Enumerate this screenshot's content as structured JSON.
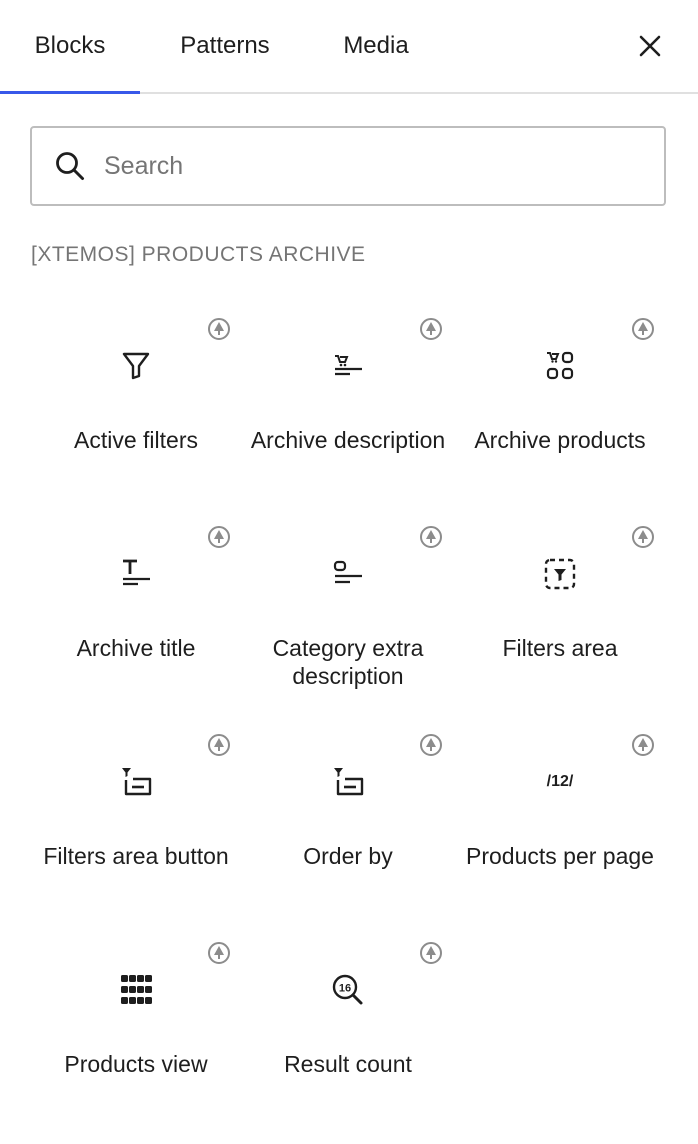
{
  "tabs": [
    {
      "label": "Blocks",
      "active": true
    },
    {
      "label": "Patterns",
      "active": false
    },
    {
      "label": "Media",
      "active": false
    }
  ],
  "close_icon": "close-icon",
  "search": {
    "placeholder": "Search",
    "value": ""
  },
  "section": {
    "title": "[XTEMOS] PRODUCTS ARCHIVE"
  },
  "colors": {
    "accent": "#3858e9",
    "text": "#1e1e1e",
    "muted": "#757575",
    "badge": "#8c8c8c"
  },
  "blocks": [
    {
      "label": "Active filters",
      "icon": "filter-funnel-icon"
    },
    {
      "label": "Archive description",
      "icon": "archive-description-icon"
    },
    {
      "label": "Archive products",
      "icon": "archive-products-icon"
    },
    {
      "label": "Archive title",
      "icon": "archive-title-icon"
    },
    {
      "label": "Category extra description",
      "icon": "category-extra-description-icon"
    },
    {
      "label": "Filters area",
      "icon": "filters-area-icon"
    },
    {
      "label": "Filters area button",
      "icon": "filters-area-button-icon"
    },
    {
      "label": "Order by",
      "icon": "order-by-icon"
    },
    {
      "label": "Products per page",
      "icon": "products-per-page-icon",
      "icon_text": "/12/"
    },
    {
      "label": "Products view",
      "icon": "products-view-grid-icon"
    },
    {
      "label": "Result count",
      "icon": "result-count-icon",
      "icon_text": "16"
    }
  ]
}
